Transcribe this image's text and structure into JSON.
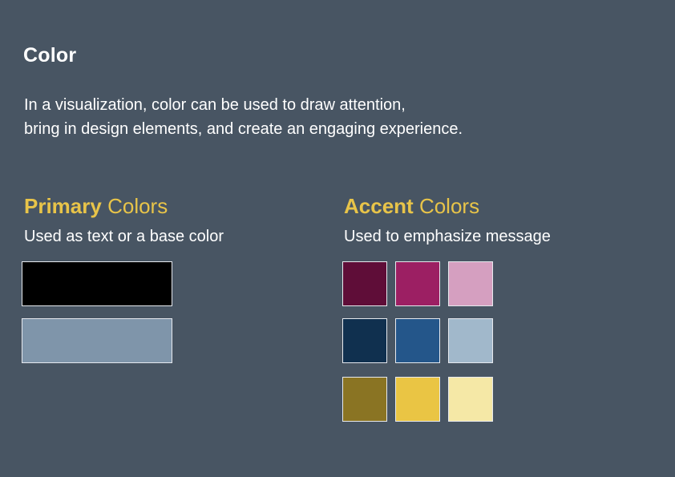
{
  "title": "Color",
  "intro": {
    "line1": "In a visualization, color can be used to draw attention,",
    "line2": "bring in design elements, and create an engaging experience."
  },
  "primary": {
    "heading_bold": "Primary",
    "heading_light": "Colors",
    "subtitle": "Used as text or a base color",
    "swatches": [
      "#000000",
      "#7f95aa"
    ]
  },
  "accent": {
    "heading_bold": "Accent",
    "heading_light": "Colors",
    "subtitle": "Used to emphasize message",
    "swatches": [
      [
        "#5f0d38",
        "#9c1f63",
        "#d59fc0"
      ],
      [
        "#10304f",
        "#24568a",
        "#a1b8cb"
      ],
      [
        "#8a7423",
        "#eac544",
        "#f5e8a6"
      ]
    ]
  }
}
